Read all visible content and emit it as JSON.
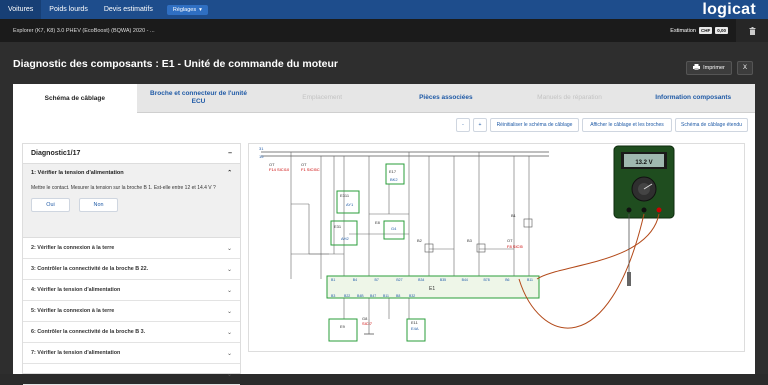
{
  "topnav": {
    "items": [
      "Voitures",
      "Poids lourds",
      "Devis estimatifs"
    ],
    "settings_label": "Réglages",
    "logo": "logicat"
  },
  "vehicle": {
    "label": "Explorer (K7, K8) 3.0 PHEV (EcoBoost) (BQWA) 2020 - ...",
    "estimation_label": "Estimation",
    "currency": "CHF",
    "amount": "0,00"
  },
  "modal": {
    "title": "Diagnostic des composants : E1 - Unité de commande du moteur",
    "print_label": "Imprimer",
    "close_label": "X"
  },
  "tabs": [
    {
      "label": "Schéma de câblage"
    },
    {
      "label": "Broche et connecteur de l'unité ECU"
    },
    {
      "label": "Emplacement"
    },
    {
      "label": "Pièces associées"
    },
    {
      "label": "Manuels de réparation"
    },
    {
      "label": "Information composants"
    }
  ],
  "toolbar": {
    "zoom_out": "-",
    "zoom_in": "+",
    "reset": "Réinitialiser le schéma de câblage",
    "show_pins": "Afficher le câblage et les broches",
    "extended": "Schéma de câblage étendu"
  },
  "diagnostic": {
    "header": "Diagnostic1/17",
    "collapse": "–",
    "open_step": {
      "title": "1: Vérifier la tension d'alimentation",
      "text": "Mettre le contact. Mesurer la tension sur la broche B 1. Est-elle entre 12 et 14.4 V ?",
      "yes": "Oui",
      "no": "Non"
    },
    "steps": [
      "2: Vérifier la connexion à la terre",
      "3: Contrôler la connectivité de la broche B 22.",
      "4: Vérifier la tension d'alimentation",
      "5: Vérifier la connexion à la terre",
      "6: Contrôler la connectivité de la broche B 3.",
      "7: Vérifier la tension d'alimentation"
    ]
  },
  "schematic": {
    "multimeter_reading": "13.2 V",
    "labels": {
      "l31": "31",
      "l15": "15",
      "ot1": "OT",
      "ot1b": "F14 SICI10",
      "ot2": "OT",
      "ot2b": "F1 SICI5C",
      "e17": "E17",
      "e17b": "BK2",
      "e311": "E311",
      "e311b": "AY1",
      "e31": "E31",
      "e31b": "AH2",
      "e8": "E8",
      "k2": "K2",
      "g4": "G4",
      "b2": "B2",
      "b3": "B3",
      "ot3": "OT",
      "ot3b": "F8 SICI5",
      "b1": "B1",
      "e1": "E1",
      "e9": "E9",
      "g8": "G8",
      "g8b": "SICI7",
      "e11": "E11",
      "e11b": "E4A"
    },
    "pins_top": [
      "B1",
      "B4",
      "B7",
      "B27",
      "B34",
      "B35",
      "B44",
      "B78",
      "B6",
      "B11"
    ],
    "pins_bottom": [
      "B3",
      "B22",
      "B4B",
      "B47",
      "B11",
      "B8",
      "B32"
    ]
  }
}
